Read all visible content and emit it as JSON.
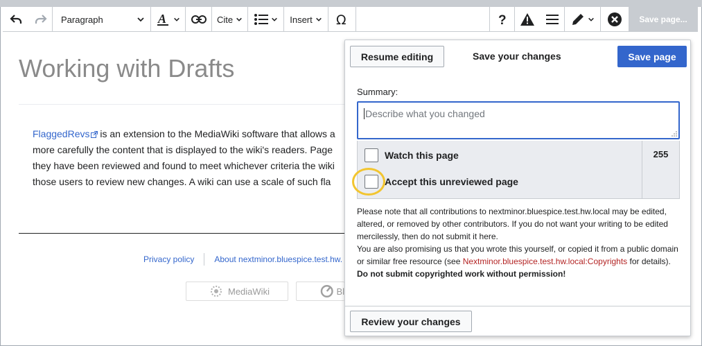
{
  "toolbar": {
    "paragraph_label": "Paragraph",
    "cite_label": "Cite",
    "insert_label": "Insert",
    "save_label": "Save page..."
  },
  "page": {
    "title": "Working with Drafts",
    "link_text": "FlaggedRevs",
    "line1_rest": " is an extension to the MediaWiki software that allows a",
    "line2": "more carefully the content that is displayed to the wiki's readers. Page",
    "line3": "they have been reviewed and found to meet whichever criteria the wiki",
    "line4": "those users to review new changes. A wiki can use a scale of such fla"
  },
  "footer": {
    "privacy": "Privacy policy",
    "about": "About nextminor.bluespice.test.hw.",
    "badge_mediawiki": "MediaWiki",
    "badge_bluespice": "Bl"
  },
  "dialog": {
    "resume_label": "Resume editing",
    "title": "Save your changes",
    "save_label": "Save page",
    "summary_label": "Summary:",
    "summary_placeholder": "Describe what you changed",
    "char_count": "255",
    "watch_label": "Watch this page",
    "accept_label": "Accept this unreviewed page",
    "notice_1": "Please note that all contributions to nextminor.bluespice.test.hw.local may be edited, altered, or removed by other contributors. If you do not want your writing to be edited mercilessly, then do not submit it here.",
    "notice_2a": "You are also promising us that you wrote this yourself, or copied it from a public domain or similar free resource (see ",
    "notice_link": "Nextminor.bluespice.test.hw.local:Copyrights",
    "notice_2b": " for details). ",
    "notice_bold": "Do not submit copyrighted work without permission!",
    "review_label": "Review your changes"
  },
  "colors": {
    "accent": "#3366cc",
    "link_red": "#b32424",
    "highlight": "#f2c530"
  }
}
